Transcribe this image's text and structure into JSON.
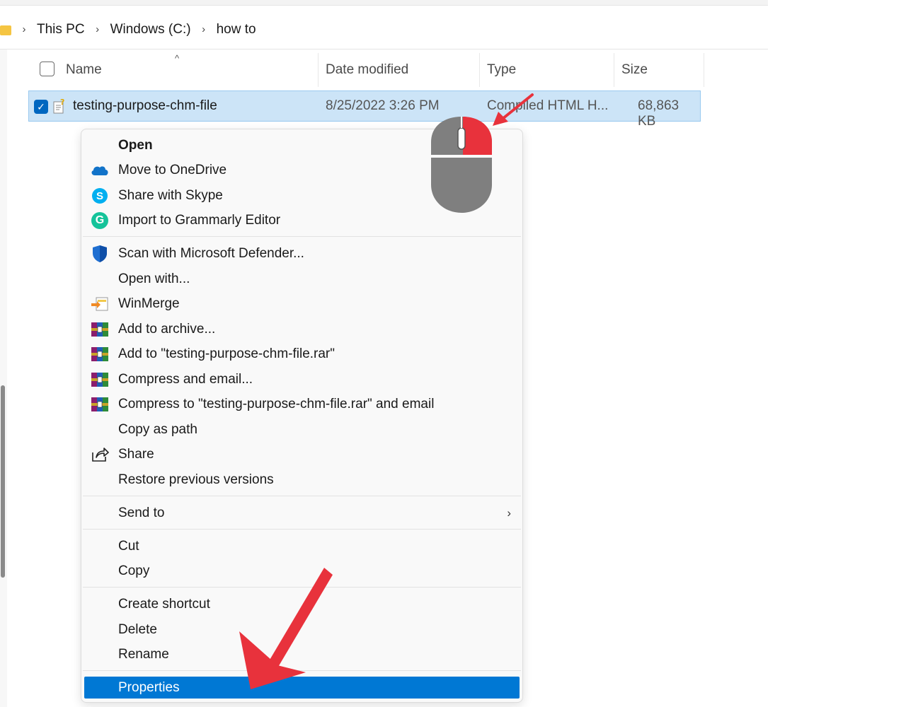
{
  "breadcrumb": {
    "items": [
      "This PC",
      "Windows (C:)",
      "how to"
    ],
    "separator": "›"
  },
  "columns": {
    "name": "Name",
    "date": "Date modified",
    "type": "Type",
    "size": "Size"
  },
  "file": {
    "name": "testing-purpose-chm-file",
    "date": "8/25/2022 3:26 PM",
    "type": "Compiled HTML H...",
    "size": "68,863 KB",
    "selected": true
  },
  "context_menu": {
    "open": "Open",
    "onedrive": "Move to OneDrive",
    "skype": "Share with Skype",
    "grammarly": "Import to Grammarly Editor",
    "defender": "Scan with Microsoft Defender...",
    "open_with": "Open with...",
    "winmerge": "WinMerge",
    "add_archive": "Add to archive...",
    "add_rar": "Add to \"testing-purpose-chm-file.rar\"",
    "compress_email": "Compress and email...",
    "compress_rar_email": "Compress to \"testing-purpose-chm-file.rar\" and email",
    "copy_path": "Copy as path",
    "share": "Share",
    "restore": "Restore previous versions",
    "send_to": "Send to",
    "cut": "Cut",
    "copy": "Copy",
    "create_shortcut": "Create shortcut",
    "delete": "Delete",
    "rename": "Rename",
    "properties": "Properties",
    "highlighted_item": "Properties"
  },
  "colors": {
    "selection": "#cce4f7",
    "menu_highlight": "#0078d4",
    "annotation_arrow": "#e8323c",
    "mouse_body": "#7f7f7f",
    "mouse_button": "#e8323c"
  }
}
